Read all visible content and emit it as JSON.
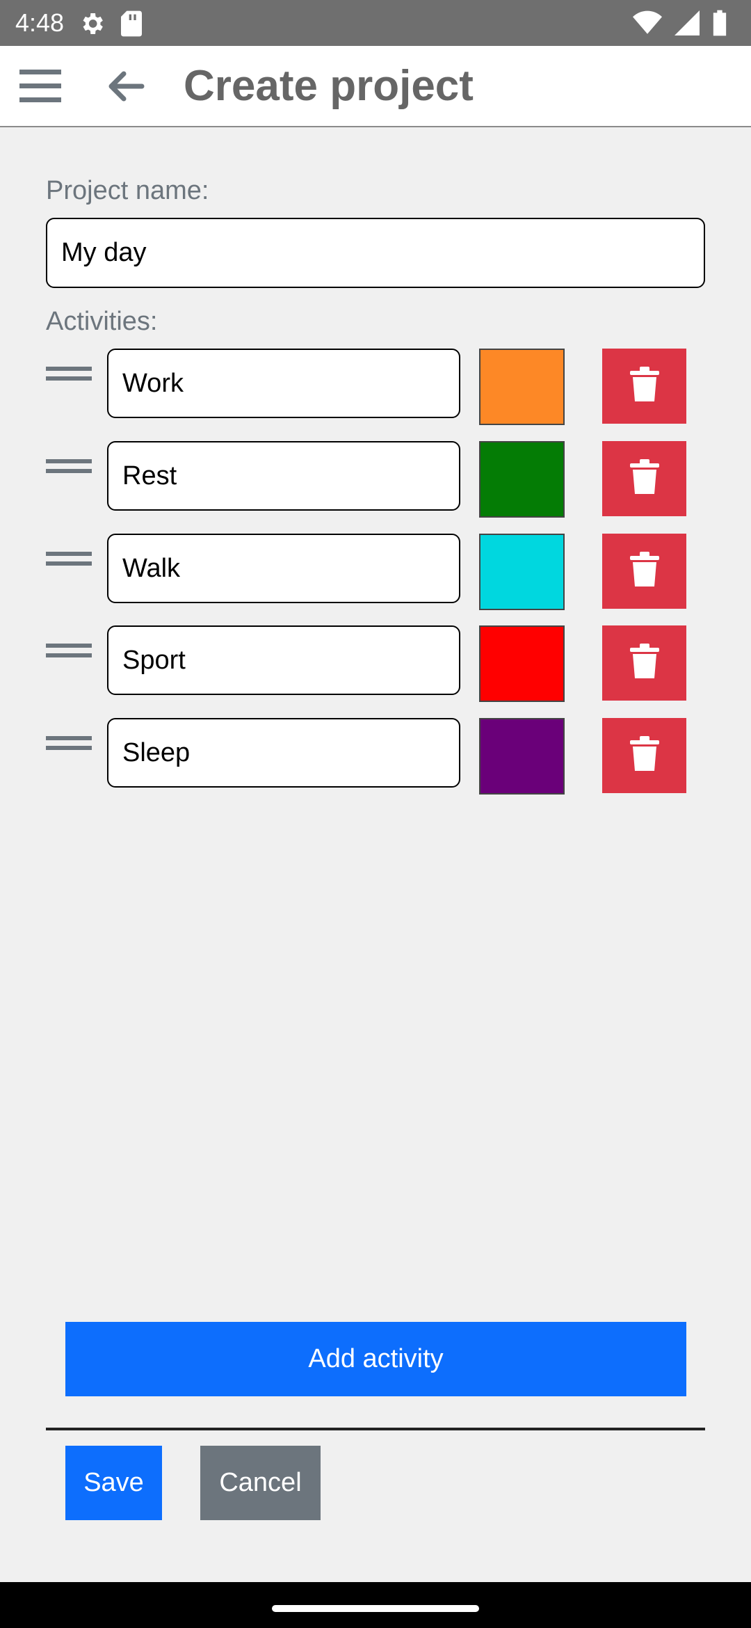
{
  "status_bar": {
    "time": "4:48",
    "icons_left": [
      "settings-icon",
      "sd-card-icon"
    ],
    "icons_right": [
      "wifi-icon",
      "signal-icon",
      "battery-icon"
    ]
  },
  "app_bar": {
    "title": "Create project",
    "menu_icon": "menu-icon",
    "back_icon": "arrow-back-icon"
  },
  "form": {
    "project_name_label": "Project name:",
    "project_name_value": "My day",
    "activities_label": "Activities:"
  },
  "activities": [
    {
      "name": "Work",
      "color": "#fd8826"
    },
    {
      "name": "Rest",
      "color": "#047c05"
    },
    {
      "name": "Walk",
      "color": "#00d7df"
    },
    {
      "name": "Sport",
      "color": "#ff0000"
    },
    {
      "name": "Sleep",
      "color": "#6a0079"
    }
  ],
  "buttons": {
    "add_activity": "Add activity",
    "save": "Save",
    "cancel": "Cancel"
  },
  "colors": {
    "primary": "#0d6efd",
    "danger": "#dc3545",
    "secondary": "#6c757d"
  }
}
